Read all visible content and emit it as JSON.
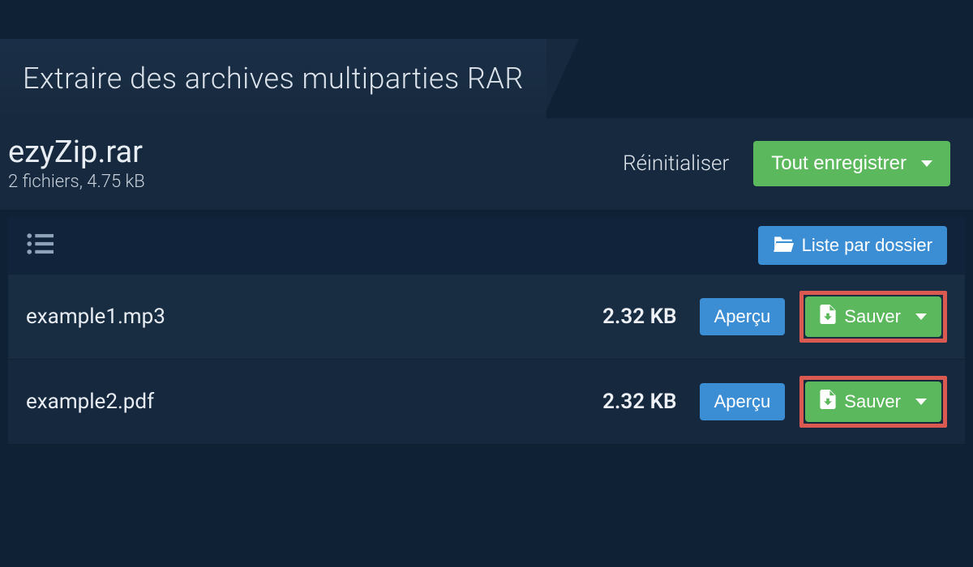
{
  "tab": {
    "title": "Extraire des archives multiparties RAR"
  },
  "archive": {
    "filename": "ezyZip.rar",
    "meta": "2 fichiers, 4.75 kB"
  },
  "actions": {
    "reset": "Réinitialiser",
    "save_all": "Tout enregistrer",
    "folder_list": "Liste par dossier"
  },
  "buttons": {
    "preview": "Aperçu",
    "save": "Sauver"
  },
  "files": [
    {
      "name": "example1.mp3",
      "size": "2.32 KB"
    },
    {
      "name": "example2.pdf",
      "size": "2.32 KB"
    }
  ]
}
